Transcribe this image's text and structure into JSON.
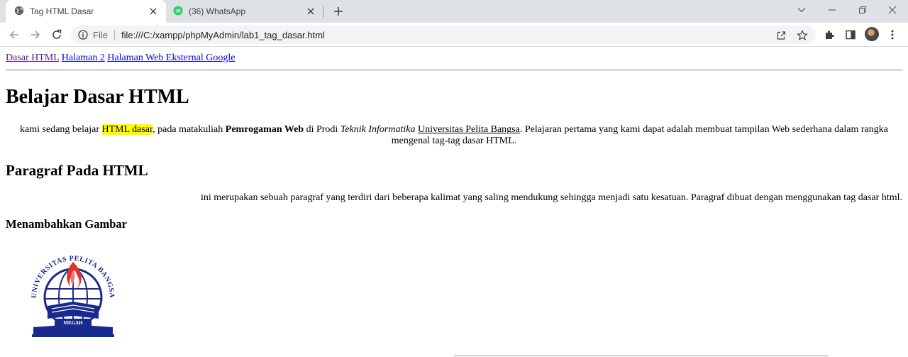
{
  "browser": {
    "tabs": [
      {
        "title": "Tag HTML Dasar",
        "active": true,
        "icon": "globe-icon"
      },
      {
        "title": "(36) WhatsApp",
        "active": false,
        "icon": "whatsapp-icon",
        "badge": "36"
      }
    ],
    "address": {
      "scheme_label": "File",
      "url": "file:///C:/xampp/phpMyAdmin/lab1_tag_dasar.html"
    }
  },
  "page": {
    "nav_links": [
      "Dasar HTML",
      "Halaman 2",
      "Halaman Web Eksternal Google"
    ],
    "heading1": "Belajar Dasar HTML",
    "intro": {
      "t1": "kami sedang belajar ",
      "highlight": "HTML dasar",
      "t2": ", pada matakuliah ",
      "bold": "Pemrogaman Web",
      "t3": " di Prodi ",
      "italic": "Teknik Informatika",
      "t4": " ",
      "underline": "Universitas Pelita Bangsa",
      "t5": ". Pelajaran pertama yang kami dapat adalah membuat tampilan Web sederhana dalam rangka mengenal tag-tag dasar HTML."
    },
    "heading2": "Paragraf Pada HTML",
    "paragraph": "ini merupakan sebuah paragraf yang terdiri dari beberapa kalimat yang saling mendukung sehingga menjadi satu kesatuan. Paragraf dibuat dengan menggunakan tag dasar html.",
    "heading3": "Menambahkan Gambar",
    "logo": {
      "ring_text": "UNIVERSITAS PELITA BANGSA",
      "banner": "MEGAH",
      "colors": {
        "navy": "#1a2a8c",
        "flame": "#e0312b"
      }
    }
  },
  "colors": {
    "link": "#0000ee",
    "visited": "#551a8b",
    "highlight": "#ffff00",
    "chrome_bg": "#dee1e6",
    "whatsapp": "#25d366"
  }
}
